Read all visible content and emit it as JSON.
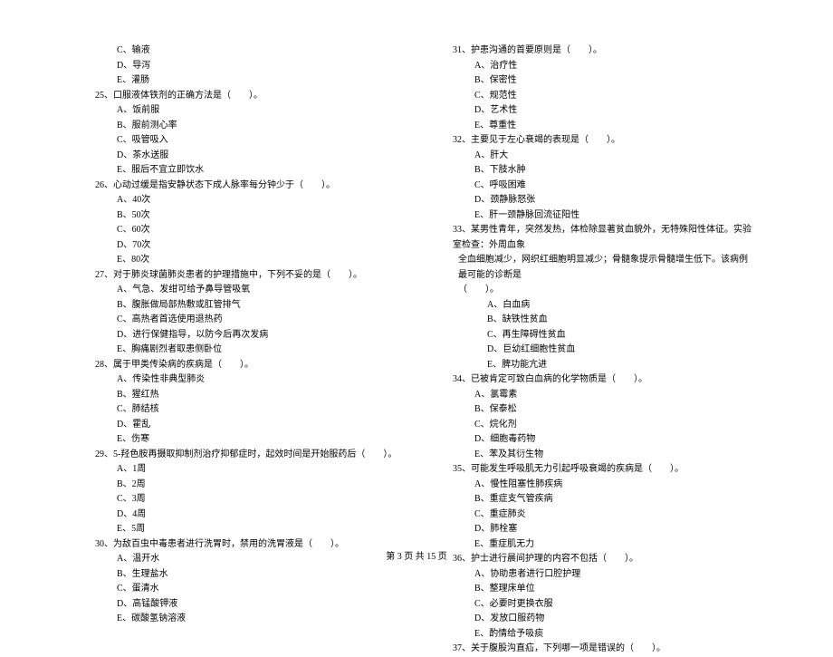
{
  "left_column": [
    {
      "type": "option",
      "text": "C、输液"
    },
    {
      "type": "option",
      "text": "D、导泻"
    },
    {
      "type": "option",
      "text": "E、灌肠"
    },
    {
      "type": "question",
      "text": "25、口服液体铁剂的正确方法是（　　）。"
    },
    {
      "type": "option",
      "text": "A、饭前服"
    },
    {
      "type": "option",
      "text": "B、服前测心率"
    },
    {
      "type": "option",
      "text": "C、吸管吸入"
    },
    {
      "type": "option",
      "text": "D、茶水送服"
    },
    {
      "type": "option",
      "text": "E、服后不宜立即饮水"
    },
    {
      "type": "question",
      "text": "26、心动过缓是指安静状态下成人脉率每分钟少于（　　）。"
    },
    {
      "type": "option",
      "text": "A、40次"
    },
    {
      "type": "option",
      "text": "B、50次"
    },
    {
      "type": "option",
      "text": "C、60次"
    },
    {
      "type": "option",
      "text": "D、70次"
    },
    {
      "type": "option",
      "text": "E、80次"
    },
    {
      "type": "question",
      "text": "27、对于肺炎球菌肺炎患者的护理措施中，下列不妥的是（　　）。"
    },
    {
      "type": "option",
      "text": "A、气急、发绀可给予鼻导管吸氧"
    },
    {
      "type": "option",
      "text": "B、腹胀做局部热敷或肛管排气"
    },
    {
      "type": "option",
      "text": "C、高热者首选使用退热药"
    },
    {
      "type": "option",
      "text": "D、进行保健指导，以防今后再次发病"
    },
    {
      "type": "option",
      "text": "E、胸痛剧烈者取患侧卧位"
    },
    {
      "type": "question",
      "text": "28、属于甲类传染病的疾病是（　　）。"
    },
    {
      "type": "option",
      "text": "A、传染性非典型肺炎"
    },
    {
      "type": "option",
      "text": "B、猩红热"
    },
    {
      "type": "option",
      "text": "C、肺结核"
    },
    {
      "type": "option",
      "text": "D、霍乱"
    },
    {
      "type": "option",
      "text": "E、伤寒"
    },
    {
      "type": "question",
      "text": "29、5-羟色胺再摄取抑制剂治疗抑郁症时，起效时间是开始服药后（　　）。"
    },
    {
      "type": "option",
      "text": "A、1周"
    },
    {
      "type": "option",
      "text": "B、2周"
    },
    {
      "type": "option",
      "text": "C、3周"
    },
    {
      "type": "option",
      "text": "D、4周"
    },
    {
      "type": "option",
      "text": "E、5周"
    },
    {
      "type": "question",
      "text": "30、为敌百虫中毒患者进行洗胃时，禁用的洗胃液是（　　）。"
    },
    {
      "type": "option",
      "text": "A、温开水"
    },
    {
      "type": "option",
      "text": "B、生理盐水"
    },
    {
      "type": "option",
      "text": "C、蛋清水"
    },
    {
      "type": "option",
      "text": "D、高锰酸钾液"
    },
    {
      "type": "option",
      "text": "E、碳酸氢钠溶液"
    }
  ],
  "right_column": [
    {
      "type": "question",
      "text": "31、护患沟通的首要原则是（　　）。"
    },
    {
      "type": "option",
      "text": "A、治疗性"
    },
    {
      "type": "option",
      "text": "B、保密性"
    },
    {
      "type": "option",
      "text": "C、规范性"
    },
    {
      "type": "option",
      "text": "D、艺术性"
    },
    {
      "type": "option",
      "text": "E、尊重性"
    },
    {
      "type": "question",
      "text": "32、主要见于左心衰竭的表现是（　　）。"
    },
    {
      "type": "option",
      "text": "A、肝大"
    },
    {
      "type": "option",
      "text": "B、下肢水肿"
    },
    {
      "type": "option",
      "text": "C、呼吸困难"
    },
    {
      "type": "option",
      "text": "D、颈静脉怒张"
    },
    {
      "type": "option",
      "text": "E、肝一颈静脉回流征阳性"
    },
    {
      "type": "question",
      "text": "33、某男性青年，突然发热，体检除显著贫血貌外，无特殊阳性体征。实验室检查：外周血象"
    },
    {
      "type": "q33cont",
      "text": "全血细胞减少，网织红细胞明显减少；骨髓象提示骨髓增生低下。该病例最可能的诊断是"
    },
    {
      "type": "q33cont",
      "text": "（　　）。"
    },
    {
      "type": "opt33",
      "text": "A、白血病"
    },
    {
      "type": "opt33",
      "text": "B、缺铁性贫血"
    },
    {
      "type": "opt33",
      "text": "C、再生障碍性贫血"
    },
    {
      "type": "opt33",
      "text": "D、巨幼红细胞性贫血"
    },
    {
      "type": "opt33",
      "text": "E、脾功能亢进"
    },
    {
      "type": "question",
      "text": "34、已被肯定可致白血病的化学物质是（　　）。"
    },
    {
      "type": "option",
      "text": "A、氯霉素"
    },
    {
      "type": "option",
      "text": "B、保泰松"
    },
    {
      "type": "option",
      "text": "C、烷化剂"
    },
    {
      "type": "option",
      "text": "D、细胞毒药物"
    },
    {
      "type": "option",
      "text": "E、苯及其衍生物"
    },
    {
      "type": "question",
      "text": "35、可能发生呼吸肌无力引起呼吸衰竭的疾病是（　　）。"
    },
    {
      "type": "option",
      "text": "A、慢性阻塞性肺疾病"
    },
    {
      "type": "option",
      "text": "B、重症支气管疾病"
    },
    {
      "type": "option",
      "text": "C、重症肺炎"
    },
    {
      "type": "option",
      "text": "D、肺栓塞"
    },
    {
      "type": "option",
      "text": "E、重症肌无力"
    },
    {
      "type": "question",
      "text": "36、护士进行晨间护理的内容不包括（　　）。"
    },
    {
      "type": "option",
      "text": "A、协助患者进行口腔护理"
    },
    {
      "type": "option",
      "text": "B、整理床单位"
    },
    {
      "type": "option",
      "text": "C、必要时更换衣服"
    },
    {
      "type": "option",
      "text": "D、发放口服药物"
    },
    {
      "type": "option",
      "text": "E、酌情给予吸痰"
    },
    {
      "type": "question",
      "text": "37、关于腹股沟直疝，下列哪一项是错误的（　　）。"
    }
  ],
  "footer": "第 3 页 共 15 页"
}
